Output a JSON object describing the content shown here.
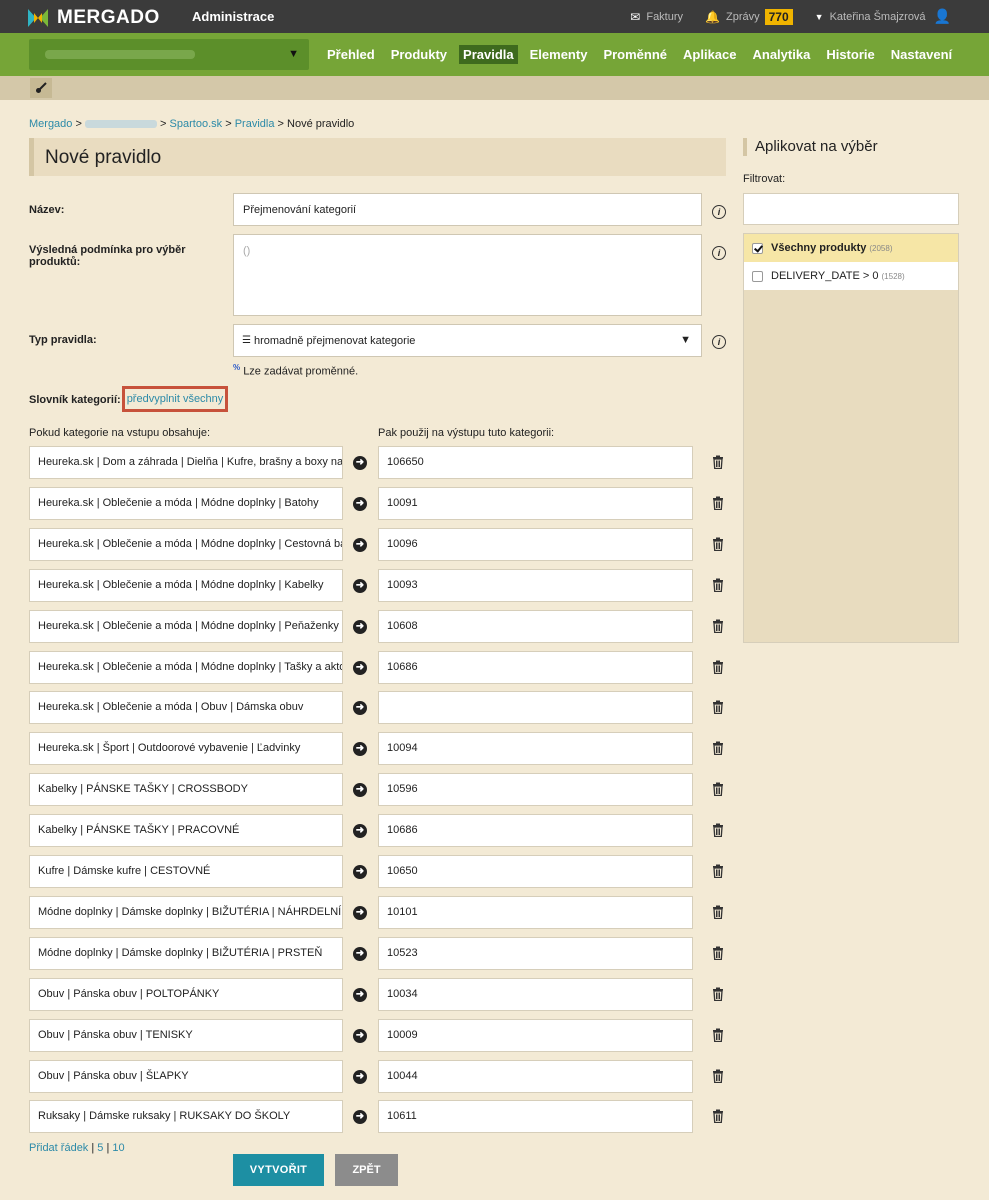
{
  "header": {
    "brand": "MERGADO",
    "section": "Administrace",
    "invoices_label": "Faktury",
    "messages_label": "Zprávy",
    "messages_count": "770",
    "user_name": "Kateřina Šmajzrová"
  },
  "nav": {
    "items": [
      "Přehled",
      "Produkty",
      "Pravidla",
      "Elementy",
      "Proměnné",
      "Aplikace",
      "Analytika",
      "Historie",
      "Nastavení"
    ],
    "active_index": 2
  },
  "breadcrumb": {
    "root": "Mergado",
    "shop": "Spartoo.sk",
    "rules": "Pravidla",
    "current": "Nové pravidlo",
    "sep": ">"
  },
  "page": {
    "title": "Nové pravidlo"
  },
  "form": {
    "name_label": "Název:",
    "name_value": "Přejmenování kategorií",
    "condition_label": "Výsledná podmínka pro výběr produktů:",
    "condition_value": "()",
    "type_label": "Typ pravidla:",
    "type_value": "hromadně přejmenovat kategorie",
    "variables_note_mark": "%",
    "variables_note": "Lze zadávat proměnné.",
    "dictionary_label": "Slovník kategorií:",
    "prefill_link": "předvyplnit všechny",
    "input_col_header": "Pokud kategorie na vstupu obsahuje:",
    "output_col_header": "Pak použij na výstupu tuto kategorii:"
  },
  "rules": [
    {
      "input": "Heureka.sk | Dom a záhrada | Dielňa | Kufre, brašny a boxy na",
      "output": "106650"
    },
    {
      "input": "Heureka.sk | Oblečenie a móda | Módne doplnky | Batohy",
      "output": "10091"
    },
    {
      "input": "Heureka.sk | Oblečenie a móda | Módne doplnky | Cestovná ba",
      "output": "10096"
    },
    {
      "input": "Heureka.sk | Oblečenie a móda | Módne doplnky | Kabelky",
      "output": "10093"
    },
    {
      "input": "Heureka.sk | Oblečenie a móda | Módne doplnky | Peňaženky",
      "output": "10608"
    },
    {
      "input": "Heureka.sk | Oblečenie a móda | Módne doplnky | Tašky a akto",
      "output": "10686"
    },
    {
      "input": "Heureka.sk | Oblečenie a móda | Obuv | Dámska obuv",
      "output": ""
    },
    {
      "input": "Heureka.sk | Šport | Outdoorové vybavenie | Ľadvinky",
      "output": "10094"
    },
    {
      "input": "Kabelky | PÁNSKE TAŠKY | CROSSBODY",
      "output": "10596"
    },
    {
      "input": "Kabelky | PÁNSKE TAŠKY | PRACOVNÉ",
      "output": "10686"
    },
    {
      "input": "Kufre | Dámske kufre | CESTOVNÉ",
      "output": "10650"
    },
    {
      "input": "Módne doplnky | Dámske doplnky | BIŽUTÉRIA | NÁHRDELNÍK",
      "output": "10101"
    },
    {
      "input": "Módne doplnky | Dámske doplnky | BIŽUTÉRIA | PRSTEŇ",
      "output": "10523"
    },
    {
      "input": "Obuv | Pánska obuv | POLTOPÁNKY",
      "output": "10034"
    },
    {
      "input": "Obuv | Pánska obuv | TENISKY",
      "output": "10009"
    },
    {
      "input": "Obuv | Pánska obuv | ŠĽAPKY",
      "output": "10044"
    },
    {
      "input": "Ruksaky | Dámske ruksaky | RUKSAKY DO ŠKOLY",
      "output": "10611"
    }
  ],
  "footer_links": {
    "add_row": "Přidat řádek",
    "sep": "|",
    "five": "5",
    "ten": "10"
  },
  "actions": {
    "create": "VYTVOŘIT",
    "back": "ZPĚT"
  },
  "sidebar": {
    "title": "Aplikovat na výběr",
    "filter_label": "Filtrovat:",
    "items": [
      {
        "label": "Všechny produkty",
        "count": "(2058)",
        "checked": true
      },
      {
        "label": "DELIVERY_DATE > 0",
        "count": "(1528)",
        "checked": false
      }
    ]
  },
  "colors": {
    "accent_teal": "#1d8fa3",
    "nav_green": "#76a537",
    "highlight_red": "#c7523b"
  },
  "icons": [
    "mergado-logo-icon",
    "invoice-icon",
    "bell-icon",
    "caret-down-icon",
    "user-icon",
    "brush-icon",
    "info-icon",
    "arrow-right-icon",
    "trash-icon",
    "checkbox-icon"
  ]
}
